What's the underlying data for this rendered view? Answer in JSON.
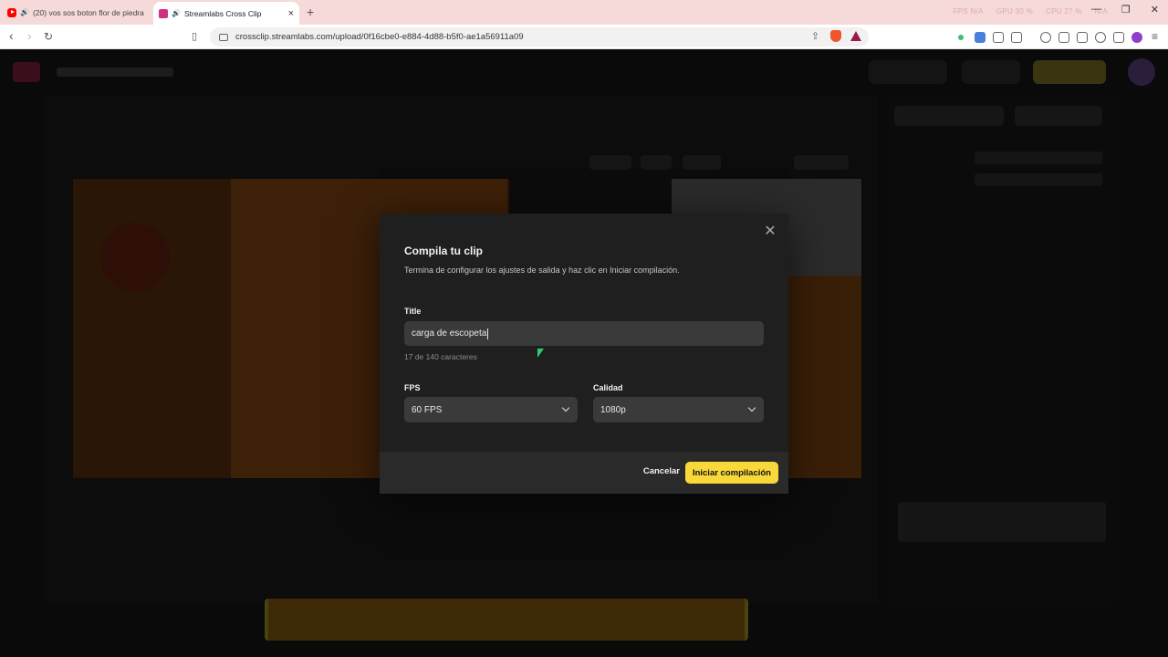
{
  "browser": {
    "tabs": [
      {
        "label": "(20) vos sos boton flor de piedra",
        "icon": "youtube-icon",
        "audio": "speaker-icon"
      },
      {
        "label": "Streamlabs Cross Clip",
        "icon": "streamlabs-icon",
        "audio": "speaker-icon",
        "active": true
      }
    ],
    "new_tab": "+",
    "close_tab": "×",
    "stats": [
      "FPS N/A",
      "GPU 30 %",
      "CPU 27 %",
      "N/A"
    ],
    "url": "crossclip.streamlabs.com/upload/0f16cbe0-e884-4d88-b5f0-ae1a56911a09"
  },
  "modal": {
    "title": "Compila tu clip",
    "subtitle": "Termina de configurar los ajustes de salida y haz clic en Iniciar compilación.",
    "title_label": "Title",
    "title_value": "carga de escopeta",
    "char_count": "17 de 140 caracteres",
    "fps_label": "FPS",
    "fps_value": "60 FPS",
    "quality_label": "Calidad",
    "quality_value": "1080p",
    "cancel": "Cancelar",
    "start": "Iniciar compilación",
    "close": "✕"
  },
  "colors": {
    "accent": "#f9d83a",
    "modal_bg": "#1f1f1f",
    "field_bg": "#3a3a3a",
    "tabbar_bg": "#f6dada"
  }
}
